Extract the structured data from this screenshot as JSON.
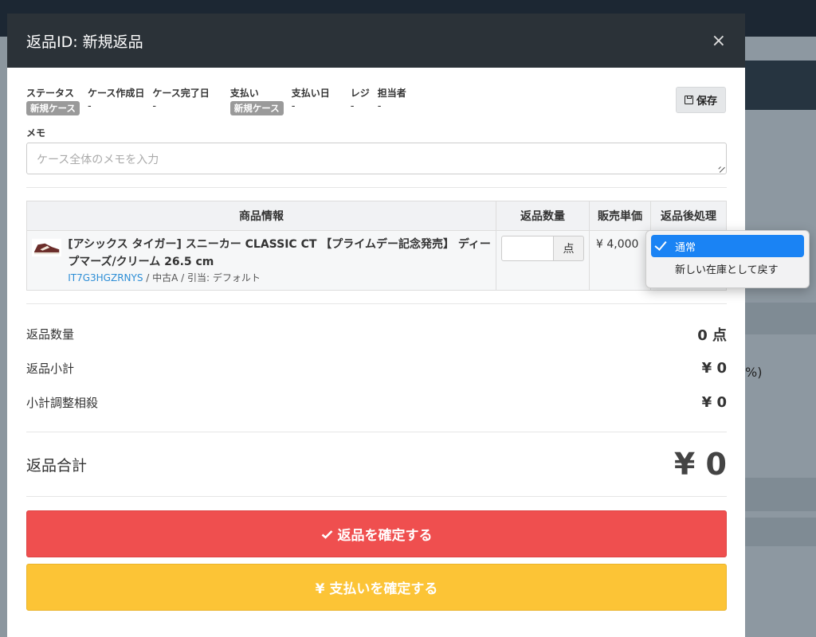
{
  "modal": {
    "title": "返品ID: 新規返品",
    "close": "×"
  },
  "meta": {
    "status_label": "ステータス",
    "status_badge": "新規ケース",
    "created_label": "ケース作成日",
    "created_val": "-",
    "completed_label": "ケース完了日",
    "completed_val": "-",
    "payment_label": "支払い",
    "payment_badge": "新規ケース",
    "payment_date_label": "支払い日",
    "payment_date_val": "-",
    "register_label": "レジ",
    "register_val": "-",
    "staff_label": "担当者",
    "staff_val": "-",
    "save_label": "保存"
  },
  "memo": {
    "label": "メモ",
    "placeholder": "ケース全体のメモを入力"
  },
  "table": {
    "headers": [
      "商品情報",
      "返品数量",
      "販売単価",
      "返品後処理"
    ],
    "rows": [
      {
        "name": "[アシックス タイガー] スニーカー CLASSIC CT 【プライムデー記念発売】 ディープマーズ/クリーム 26.5 cm",
        "code": "IT7G3HGZRNYS",
        "condition": " / 中古A / 引当: デフォルト",
        "qty_unit": "点",
        "price": "¥ 4,000"
      }
    ]
  },
  "dropdown": {
    "options": [
      "通常",
      "新しい在庫として戻す"
    ],
    "selected_index": 0
  },
  "summary": {
    "qty_label": "返品数量",
    "qty_val": "0 点",
    "subtotal_label": "返品小計",
    "subtotal_val": "¥ 0",
    "adjust_label": "小計調整相殺",
    "adjust_val": "¥ 0",
    "total_label": "返品合計",
    "total_val": "¥ 0"
  },
  "buttons": {
    "confirm": "返品を確定する",
    "pay": "¥ 支払いを確定する"
  },
  "background": {
    "text": "%)"
  },
  "colors": {
    "confirm_bg": "#ef4f4f",
    "pay_bg": "#fcc436",
    "header_bg": "#2b3238",
    "selected_bg": "#1a83f4",
    "link": "#2d8ed6"
  }
}
